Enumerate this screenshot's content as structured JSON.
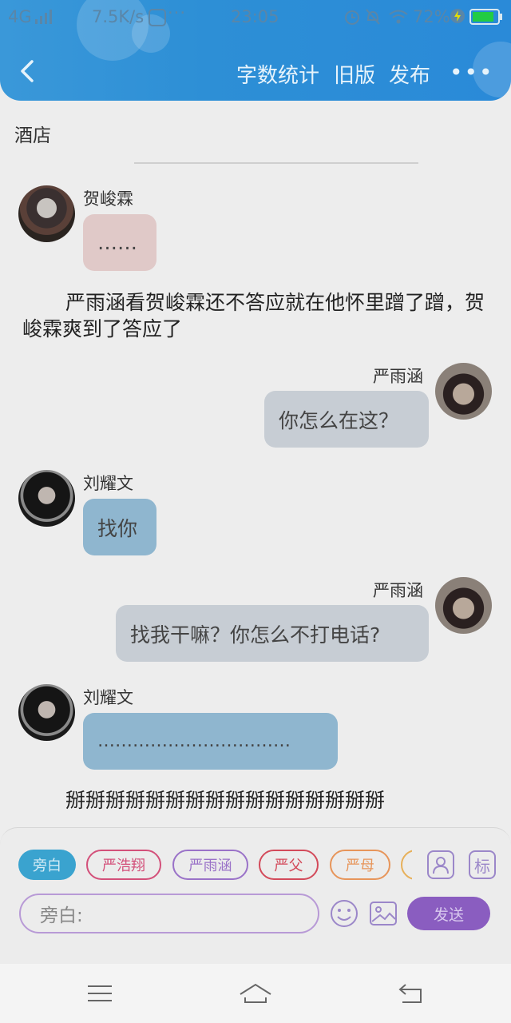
{
  "status_bar": {
    "network": "4G",
    "speed": "7.5K/s",
    "time": "23:05",
    "battery": "72%"
  },
  "header": {
    "word_count": "字数统计",
    "old_version": "旧版",
    "publish": "发布",
    "more": "•••"
  },
  "story": {
    "title": "酒店"
  },
  "messages": [
    {
      "speaker": "贺峻霖",
      "text": "……",
      "side": "left"
    },
    {
      "narration": "严雨涵看贺峻霖还不答应就在他怀里蹭了蹭，贺峻霖爽到了答应了"
    },
    {
      "speaker": "严雨涵",
      "text": "你怎么在这？",
      "side": "right"
    },
    {
      "speaker": "刘耀文",
      "text": "找你",
      "side": "left"
    },
    {
      "speaker": "严雨涵",
      "text": "找我干嘛？你怎么不打电话?",
      "side": "right"
    },
    {
      "speaker": "刘耀文",
      "text": "……………………………",
      "side": "left"
    },
    {
      "narration": "掰掰掰掰掰掰掰掰掰掰掰掰掰掰掰掰"
    }
  ],
  "composer": {
    "roles": [
      "旁白",
      "严浩翔",
      "严雨涵",
      "严父",
      "严母"
    ],
    "role_icon_label": "标",
    "placeholder": "旁白:",
    "send": "发送"
  },
  "colors": {
    "header": "#2d8fd6",
    "bubble_pink": "#e0c9c8",
    "bubble_gray": "#c7cdd4",
    "bubble_blue": "#8fb6cf",
    "send": "#8a5dc0"
  }
}
